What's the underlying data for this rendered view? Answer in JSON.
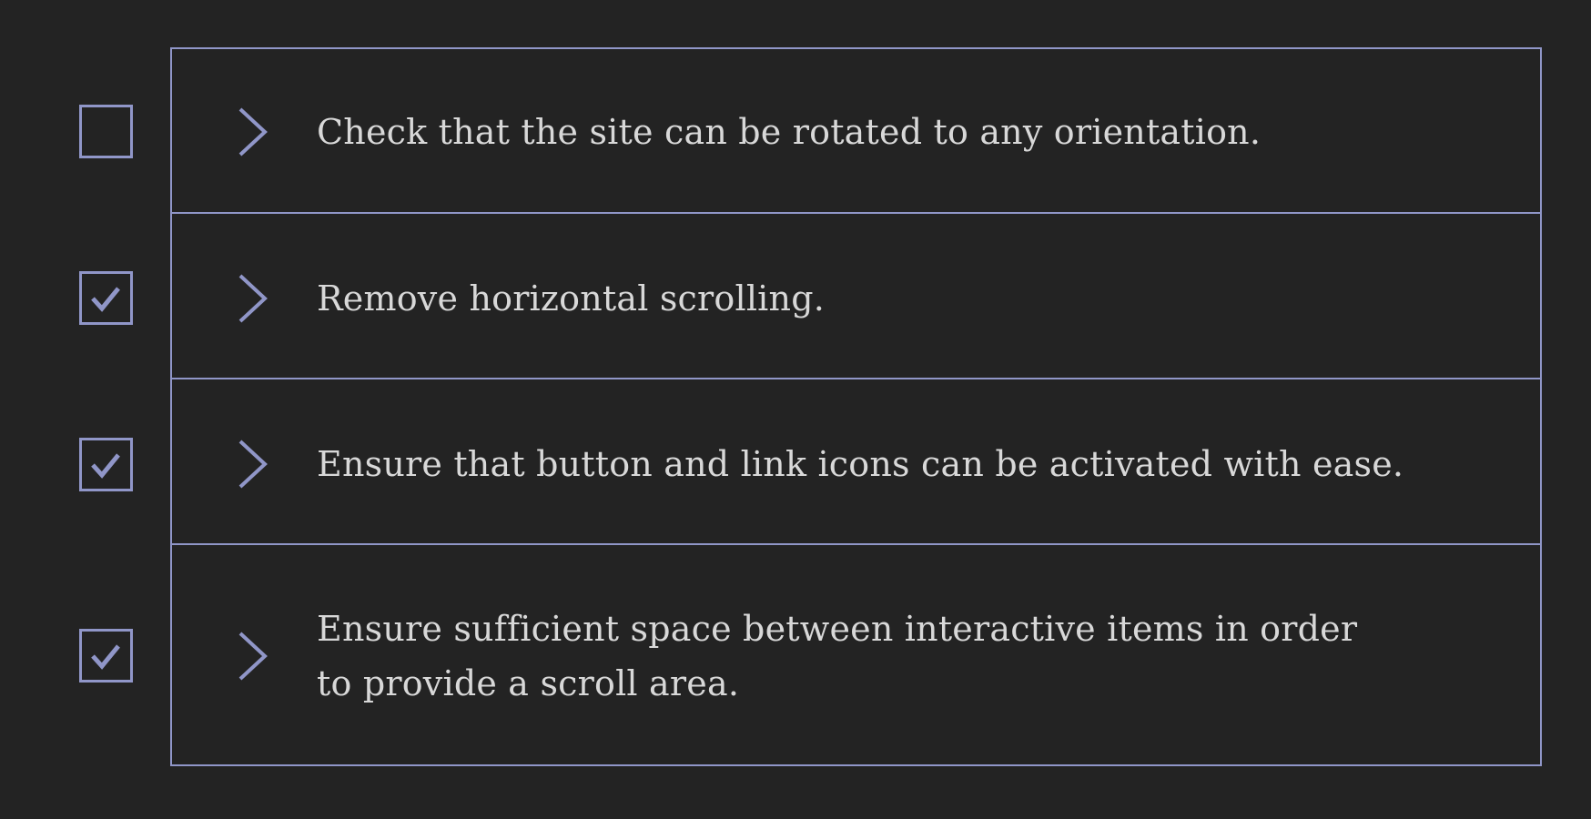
{
  "colors": {
    "background": "#232323",
    "accent": "#9096c8",
    "text": "#d8d8d8"
  },
  "checklist": {
    "items": [
      {
        "text": "Check that the site can be rotated to any orientation.",
        "checked": false,
        "checkbox_icon": "checkbox-unchecked-icon",
        "expand_icon": "chevron-right-icon"
      },
      {
        "text": "Remove horizontal scrolling.",
        "checked": true,
        "checkbox_icon": "checkbox-checked-icon",
        "expand_icon": "chevron-right-icon"
      },
      {
        "text": "Ensure that button and link icons can be activated with ease.",
        "checked": true,
        "checkbox_icon": "checkbox-checked-icon",
        "expand_icon": "chevron-right-icon"
      },
      {
        "text": "Ensure sufficient space between interactive items in order to provide a scroll area.",
        "checked": true,
        "checkbox_icon": "checkbox-checked-icon",
        "expand_icon": "chevron-right-icon"
      }
    ]
  }
}
